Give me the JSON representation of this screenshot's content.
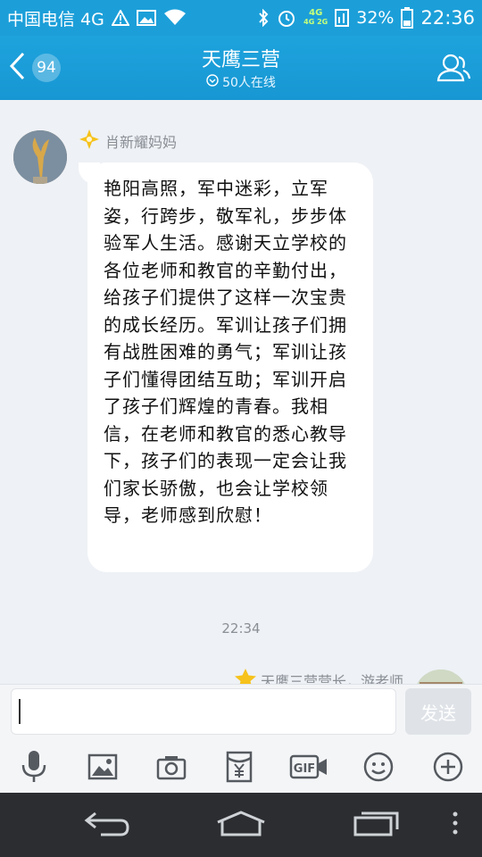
{
  "status_bar": {
    "carrier": "中国电信 4G",
    "network_top": "4G",
    "network_sub": "4G 2G",
    "battery": "32%",
    "time": "22:36"
  },
  "header": {
    "unread_count": "94",
    "title": "天鹰三营",
    "online": "50人在线"
  },
  "messages": [
    {
      "sender": "肖新耀妈妈",
      "text": "艳阳高照，军中迷彩，立军姿，行跨步，敬军礼，步步体验军人生活。感谢天立学校的各位老师和教官的辛勤付出，给孩子们提供了这样一次宝贵的成长经历。军训让孩子们拥有战胜困难的勇气；军训让孩子们懂得团结互助；军训开启了孩子们辉煌的青春。我相信，在老师和教官的悉心教导下，孩子们的表现一定会让我们家长骄傲，也会让学校领导，老师感到欣慰！"
    }
  ],
  "timestamp": "22:34",
  "next_sender": "天鹰三营营长，游老师",
  "composer": {
    "value": "",
    "send_label": "发送"
  },
  "colors": {
    "brand": "#1c9fd9",
    "chat_bg": "#eef1f5",
    "bubble": "#ffffff",
    "icon": "#555a60"
  }
}
